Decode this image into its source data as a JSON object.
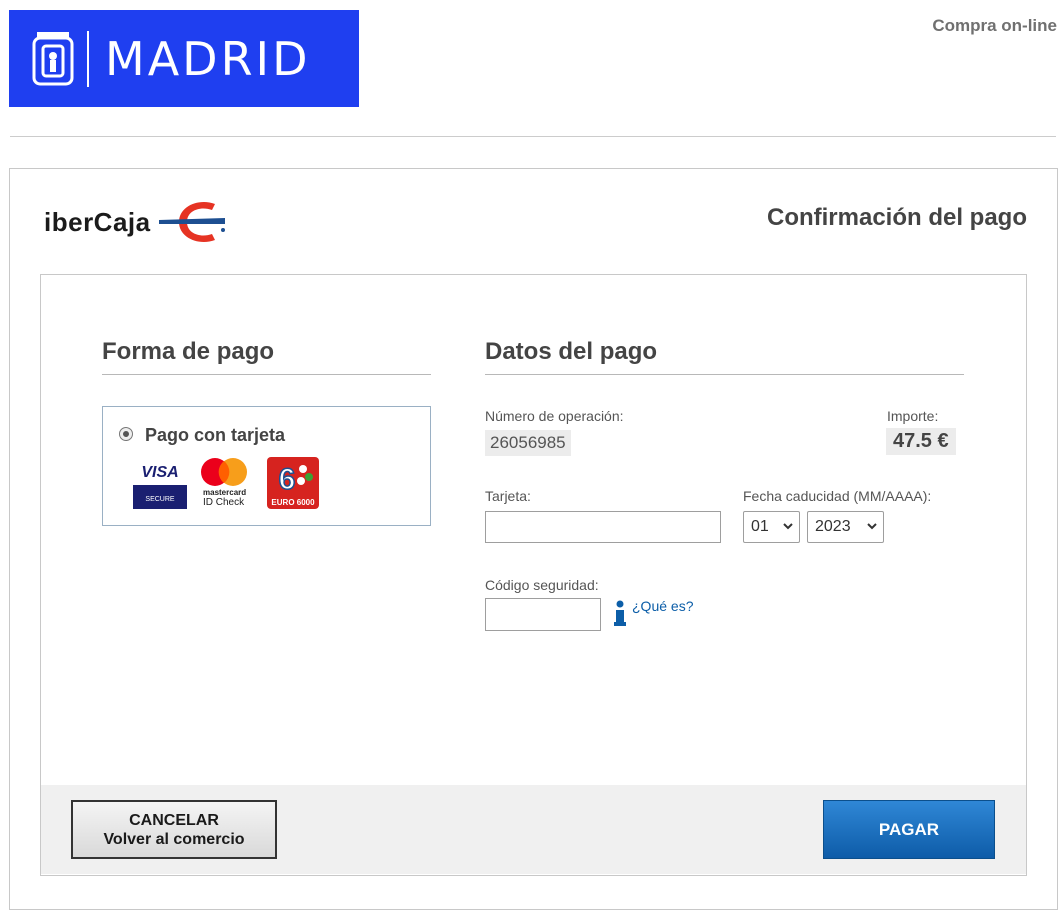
{
  "header": {
    "logo_text": "MADRID",
    "right_label": "Compra on-line"
  },
  "bank": {
    "logo_text": "iberCaja",
    "page_title": "Confirmación del pago"
  },
  "payment_method": {
    "section_title": "Forma de pago",
    "option_label": "Pago con tarjeta",
    "option_selected": true,
    "card_logos": {
      "visa_top": "VISA",
      "visa_bottom": "SECURE",
      "mastercard_line1": "mastercard",
      "mastercard_line2": "ID Check",
      "euro6000_label": "EURO 6000"
    }
  },
  "payment_data": {
    "section_title": "Datos del pago",
    "operation_label": "Número de operación:",
    "operation_value": "26056985",
    "amount_label": "Importe:",
    "amount_value": "47.5 €",
    "card_label": "Tarjeta:",
    "card_value": "",
    "expiry_label": "Fecha caducidad (MM/AAAA):",
    "expiry_month": "01",
    "expiry_year": "2023",
    "cvv_label": "Código seguridad:",
    "cvv_value": "",
    "cvv_help_link": "¿Qué es?"
  },
  "actions": {
    "cancel_line1": "CANCELAR",
    "cancel_line2": "Volver al comercio",
    "pay_label": "PAGAR"
  },
  "colors": {
    "madrid_blue": "#1f3ff0",
    "pay_button": "#0e5ca8",
    "link": "#0c5ea8",
    "ibercaja_red": "#e63323",
    "ibercaja_blue": "#1d4f91"
  }
}
